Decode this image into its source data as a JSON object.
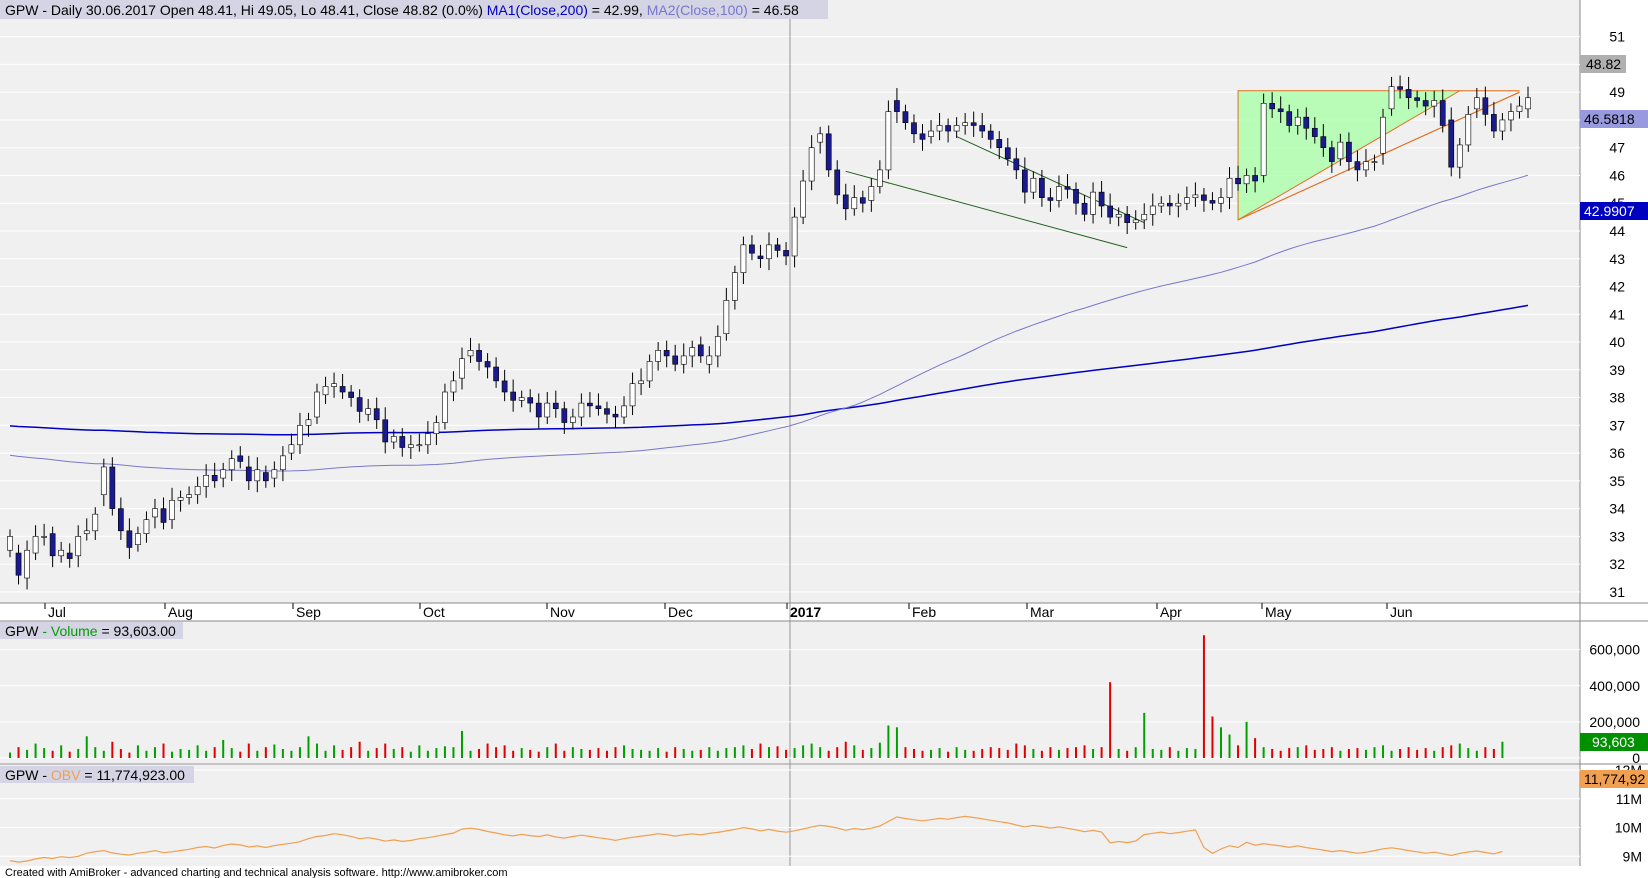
{
  "chart_data": {
    "type": "candlestick",
    "colors": {
      "up": "#ffffff",
      "down": "#1a1a8c",
      "volume_up": "#00a000",
      "volume_down": "#e00000",
      "ma200": "#0000c0",
      "ma100": "#7777cc",
      "obv": "#f0a050",
      "triangle": "#e07020",
      "wedge_fill": "#aaffaa",
      "wedge_line": "#206020"
    },
    "price_panel": {
      "header": {
        "symbol": "GPW",
        "info": " - Daily 30.06.2017 Open 48.41, Hi 49.05, Lo 48.41, Close 48.82 (0.0%) ",
        "ma1": "MA1(Close,200)",
        "ma1_value": " = 42.99, ",
        "ma2": "MA2(Close,100)",
        "ma2_value": " = 46.58"
      },
      "y_ticks": [
        31,
        32,
        33,
        34,
        35,
        36,
        37,
        38,
        39,
        40,
        41,
        42,
        43,
        44,
        45,
        46,
        47,
        48,
        49,
        50,
        51
      ],
      "y_ticks_text": [
        "31",
        "32",
        "33",
        "34",
        "35",
        "36",
        "37",
        "38",
        "39",
        "40",
        "41",
        "42",
        "43",
        "44",
        "45",
        "46",
        "47",
        "48",
        "49",
        "50",
        "51"
      ],
      "last_close_label": "48.82",
      "ma2_label": "46.5818",
      "ma1_label": "42.9907",
      "ylim": [
        30.6,
        51.6
      ]
    },
    "x_months": [
      "Jul",
      "Aug",
      "Sep",
      "Oct",
      "Nov",
      "Dec",
      "2017",
      "Feb",
      "Mar",
      "Apr",
      "May",
      "Jun"
    ],
    "closes": [
      33,
      31.6,
      32.5,
      33,
      33,
      32.3,
      32.5,
      32.2,
      33,
      33.2,
      33.8,
      35.5,
      34,
      33.2,
      32.6,
      33.1,
      33.6,
      34,
      33.5,
      34.3,
      34.4,
      34.5,
      34.8,
      35.2,
      35,
      35.4,
      35.8,
      35.7,
      35,
      35.4,
      35,
      35.4,
      35.9,
      36.3,
      37,
      37.2,
      38.2,
      38.4,
      38.5,
      38.2,
      38,
      37.5,
      37.6,
      37.2,
      36.4,
      36.6,
      36.2,
      36.3,
      36.3,
      36.7,
      37.1,
      38.2,
      38.6,
      39.4,
      39.7,
      39.3,
      39.1,
      38.6,
      38.2,
      37.9,
      38,
      37.8,
      37.3,
      37.8,
      37.6,
      37.1,
      37.3,
      37.8,
      37.7,
      37.6,
      37.4,
      37.3,
      37.7,
      38.5,
      38.6,
      39.3,
      39.7,
      39.5,
      39.2,
      39.5,
      39.8,
      39.5,
      39.5,
      40.2,
      41.5,
      42.5,
      43.5,
      43.2,
      43,
      43.5,
      43.3,
      43.1,
      44.5,
      45.8,
      47,
      47.5,
      46.2,
      45.3,
      44.8,
      45.2,
      45,
      45.6,
      46.2,
      48.3,
      48.3,
      47.9,
      47.5,
      47.3,
      47.6,
      47.8,
      47.6,
      47.8,
      47.9,
      47.8,
      47.6,
      47.3,
      47,
      46.6,
      46.2,
      45.4,
      45.9,
      45.2,
      45.1,
      45.6,
      45.5,
      45,
      44.6,
      45.4,
      44.9,
      44.5,
      44.6,
      44.3,
      44.4,
      44.6,
      44.9,
      45,
      44.9,
      45,
      45.2,
      45.3,
      45.1,
      45,
      45.2,
      45.9,
      45.7,
      46,
      45.8,
      48.6,
      48.4,
      48.3,
      47.8,
      48.1,
      47.7,
      47.4,
      47,
      46.5,
      47.2,
      46.5,
      46.2,
      46.5,
      46.5,
      48.1,
      49.2,
      49.1,
      48.8,
      48.7,
      48.5,
      48.7,
      47.8,
      46.3,
      47.1,
      48.2,
      48.8,
      48.2,
      47.6,
      48,
      48.3,
      48.5,
      48.8
    ],
    "opens": [
      32.5,
      32.4,
      31.5,
      32.4,
      33,
      33.1,
      32.3,
      32.4,
      32.3,
      33.1,
      33.2,
      34.5,
      35.5,
      34,
      33.2,
      32.7,
      33.1,
      33.7,
      34,
      33.6,
      34.3,
      34.4,
      34.5,
      34.8,
      35.2,
      35.1,
      35.4,
      35.9,
      35.5,
      35,
      35.3,
      35.1,
      35.4,
      36,
      36.3,
      37,
      37.3,
      38.1,
      38.4,
      38.4,
      38.2,
      38,
      37.4,
      37.6,
      37.2,
      36.4,
      36.6,
      36.2,
      36.3,
      36.3,
      36.7,
      37.1,
      38.2,
      38.7,
      39.5,
      39.7,
      39.3,
      39.1,
      38.6,
      38.2,
      37.9,
      38,
      37.8,
      37.3,
      37.8,
      37.6,
      37.1,
      37.3,
      37.8,
      37.7,
      37.6,
      37.4,
      37.3,
      37.7,
      38.5,
      38.6,
      39.3,
      39.7,
      39.5,
      39.2,
      39.5,
      39.9,
      39.2,
      39.5,
      40.3,
      41.5,
      42.5,
      43.5,
      43.1,
      43,
      43.5,
      43.3,
      43.1,
      44.5,
      45.8,
      47.2,
      47.5,
      46.2,
      45.3,
      44.8,
      45.2,
      45.1,
      45.6,
      46.2,
      48.7,
      48.3,
      47.9,
      47.5,
      47.4,
      47.6,
      47.8,
      47.6,
      47.8,
      47.9,
      47.8,
      47.6,
      47.3,
      47,
      46.6,
      46.2,
      45.4,
      45.9,
      45.2,
      45.1,
      45.6,
      45.5,
      45,
      44.6,
      45.4,
      44.9,
      44.5,
      44.6,
      44.3,
      44.4,
      44.6,
      44.9,
      45,
      44.9,
      45,
      45.2,
      45.3,
      45.1,
      45,
      45.2,
      45.9,
      45.7,
      46,
      46,
      48.6,
      48.4,
      48.3,
      47.8,
      48.1,
      47.7,
      47.4,
      47,
      46.6,
      47.2,
      46.5,
      46.2,
      46.5,
      46.8,
      48.4,
      49.2,
      49.1,
      48.8,
      48.7,
      48.5,
      48.7,
      48,
      46.3,
      47.1,
      48.4,
      48.8,
      48.2,
      47.6,
      48,
      48.3,
      48.4
    ],
    "volume_k": [
      30,
      60,
      45,
      80,
      55,
      40,
      70,
      35,
      50,
      120,
      60,
      40,
      90,
      50,
      30,
      70,
      40,
      60,
      80,
      35,
      50,
      45,
      70,
      40,
      60,
      100,
      55,
      35,
      80,
      40,
      60,
      75,
      50,
      40,
      60,
      120,
      80,
      40,
      70,
      45,
      60,
      90,
      40,
      55,
      80,
      50,
      60,
      35,
      70,
      40,
      55,
      65,
      60,
      150,
      40,
      50,
      80,
      60,
      70,
      40,
      55,
      45,
      35,
      60,
      80,
      40,
      60,
      50,
      45,
      55,
      40,
      60,
      70,
      50,
      45,
      40,
      55,
      35,
      60,
      50,
      40,
      45,
      60,
      40,
      55,
      60,
      70,
      50,
      80,
      60,
      65,
      45,
      55,
      70,
      80,
      60,
      40,
      60,
      90,
      70,
      45,
      55,
      85,
      180,
      170,
      60,
      50,
      40,
      45,
      55,
      35,
      60,
      45,
      40,
      50,
      60,
      55,
      45,
      80,
      70,
      50,
      40,
      60,
      45,
      55,
      60,
      70,
      50,
      60,
      420,
      50,
      40,
      60,
      250,
      50,
      45,
      60,
      40,
      55,
      50,
      680,
      230,
      170,
      130,
      70,
      200,
      110,
      60,
      50,
      40,
      55,
      60,
      70,
      45,
      50,
      60,
      40,
      50,
      55,
      45,
      60,
      70,
      40,
      50,
      60,
      45,
      55,
      40,
      60,
      70,
      80,
      55,
      40,
      60,
      50,
      90
    ],
    "volume_panel": {
      "header": {
        "symbol": "GPW",
        "name": " - Volume",
        "value": " = 93,603.00"
      },
      "y_ticks_text": [
        "0",
        "200,000",
        "400,000",
        "600,000"
      ],
      "last_label": "93,603"
    },
    "obv_panel": {
      "header": {
        "symbol": "GPW",
        "name": " - ",
        "obv": "OBV",
        "value": " = 11,774,923.00"
      },
      "y_ticks_text": [
        "9M",
        "10M",
        "11M",
        "12M"
      ],
      "last_label": "11,774,92"
    }
  },
  "footer": "Created with AmiBroker - advanced charting and technical analysis software. http://www.amibroker.com"
}
